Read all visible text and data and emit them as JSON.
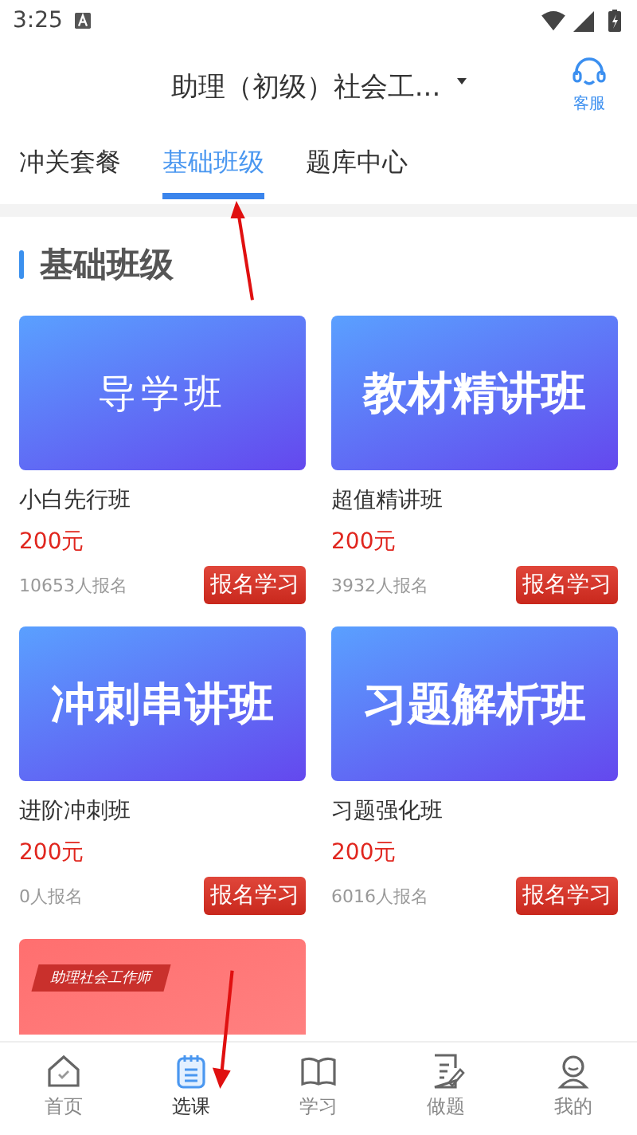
{
  "status_bar": {
    "time": "3:25"
  },
  "header": {
    "title": "助理（初级）社会工...",
    "service": "客服"
  },
  "tabs": [
    {
      "label": "冲关套餐",
      "selected": false
    },
    {
      "label": "基础班级",
      "selected": true
    },
    {
      "label": "题库中心",
      "selected": false
    }
  ],
  "section_title": "基础班级",
  "courses": [
    {
      "cover": "导学班",
      "bold": false,
      "name": "小白先行班",
      "price": "200元",
      "enrolled": "10653人报名",
      "button": "报名学习"
    },
    {
      "cover": "教材精讲班",
      "bold": true,
      "name": "超值精讲班",
      "price": "200元",
      "enrolled": "3932人报名",
      "button": "报名学习"
    },
    {
      "cover": "冲刺串讲班",
      "bold": true,
      "name": "进阶冲刺班",
      "price": "200元",
      "enrolled": "0人报名",
      "button": "报名学习"
    },
    {
      "cover": "习题解析班",
      "bold": true,
      "name": "习题强化班",
      "price": "200元",
      "enrolled": "6016人报名",
      "button": "报名学习"
    }
  ],
  "partial_course": {
    "badge": "助理社会工作师"
  },
  "nav": [
    {
      "label": "首页",
      "selected": false
    },
    {
      "label": "选课",
      "selected": true
    },
    {
      "label": "学习",
      "selected": false
    },
    {
      "label": "做题",
      "selected": false
    },
    {
      "label": "我的",
      "selected": false
    }
  ]
}
